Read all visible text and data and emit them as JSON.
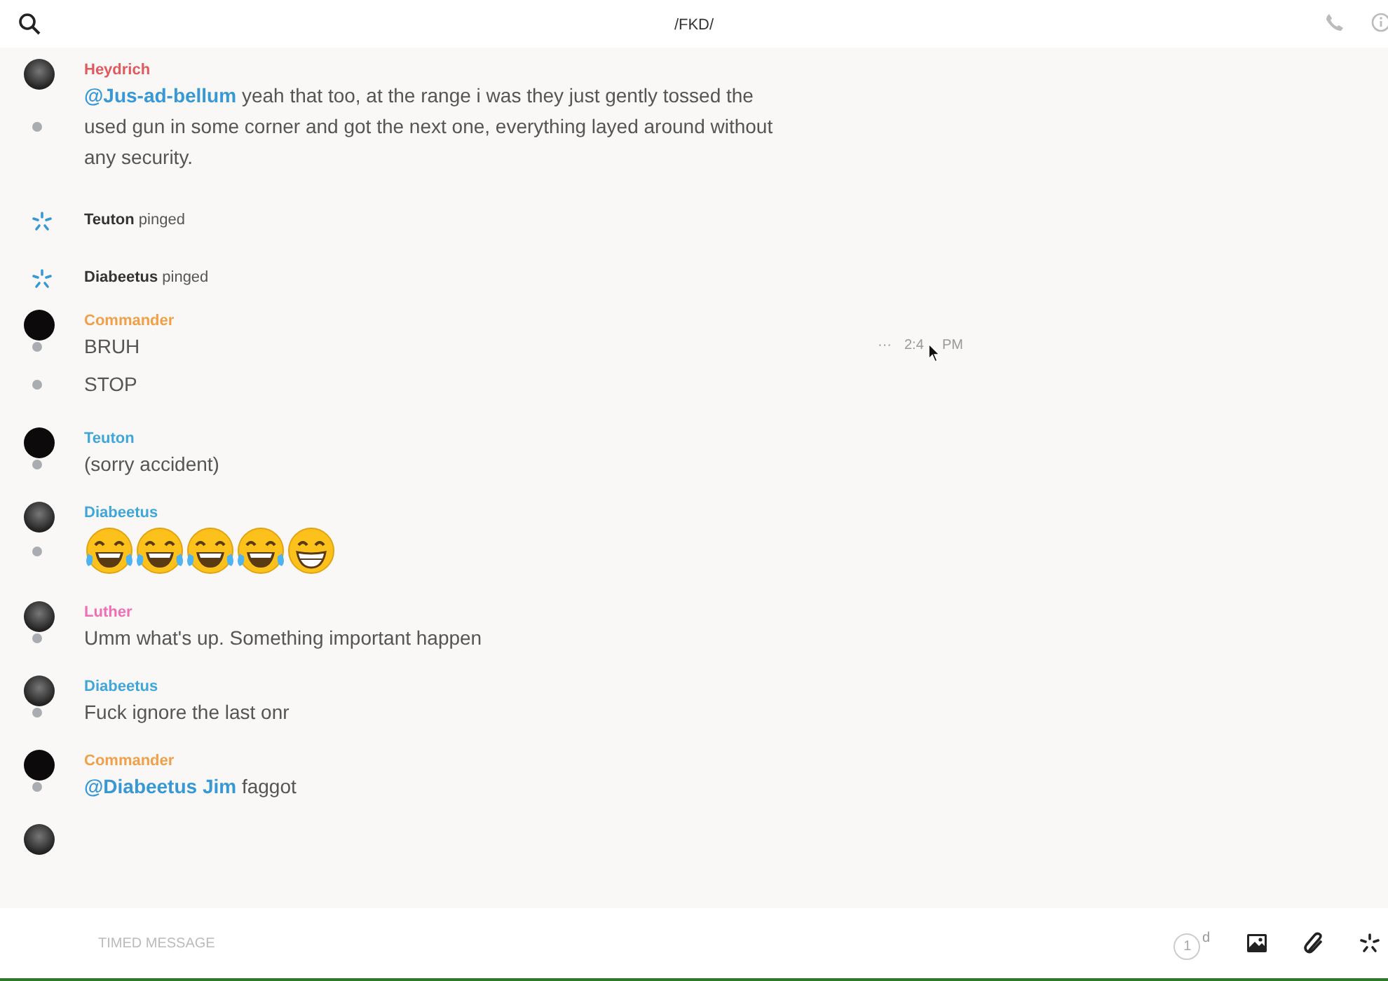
{
  "header": {
    "title": "/FKD/"
  },
  "messages": [
    {
      "kind": "message",
      "author": "Heydrich",
      "color": "#e0595e",
      "avatar": {
        "kind": "photo"
      },
      "lines": [
        {
          "kind": "text",
          "text": "**@Jus-ad-bellum** yeah that too, at the range i was they just gently tossed the used gun in some corner and got the next one, everything layed around without any security."
        }
      ]
    },
    {
      "kind": "ping",
      "author": "Teuton",
      "text": "pinged"
    },
    {
      "kind": "ping",
      "author": "Diabeetus",
      "text": "pinged"
    },
    {
      "kind": "message",
      "author": "Commander",
      "color": "#f0a048",
      "avatar": {
        "kind": "dark"
      },
      "lines": [
        {
          "kind": "text",
          "text": "BRUH",
          "more": "···",
          "time": "2:4",
          "time_suffix": "PM"
        },
        {
          "kind": "text",
          "text": "STOP"
        }
      ]
    },
    {
      "kind": "message",
      "author": "Teuton",
      "color": "#3ea6d9",
      "avatar": {
        "kind": "dark"
      },
      "lines": [
        {
          "kind": "text",
          "text": "(sorry accident)"
        }
      ]
    },
    {
      "kind": "message",
      "author": "Diabeetus",
      "color": "#3ea6d9",
      "avatar": {
        "kind": "photo"
      },
      "lines": [
        {
          "kind": "emoji",
          "emojis": [
            {
              "kind": "joy"
            },
            {
              "kind": "joy"
            },
            {
              "kind": "joy"
            },
            {
              "kind": "joy"
            },
            {
              "kind": "grin"
            }
          ]
        }
      ]
    },
    {
      "kind": "message",
      "author": "Luther",
      "color": "#ee6fb4",
      "avatar": {
        "kind": "photo"
      },
      "lines": [
        {
          "kind": "text",
          "text": "Umm what's up. Something important happen"
        }
      ]
    },
    {
      "kind": "message",
      "author": "Diabeetus",
      "color": "#3ea6d9",
      "avatar": {
        "kind": "photo"
      },
      "lines": [
        {
          "kind": "text",
          "text": "Fuck ignore the last onr"
        }
      ]
    },
    {
      "kind": "message",
      "author": "Commander",
      "color": "#f0a048",
      "avatar": {
        "kind": "dark"
      },
      "lines": [
        {
          "kind": "text",
          "text": "**@Diabeetus Jim** faggot"
        }
      ]
    }
  ],
  "composer": {
    "placeholder": "TIMED MESSAGE",
    "timer": "1",
    "timer_unit": "d"
  }
}
